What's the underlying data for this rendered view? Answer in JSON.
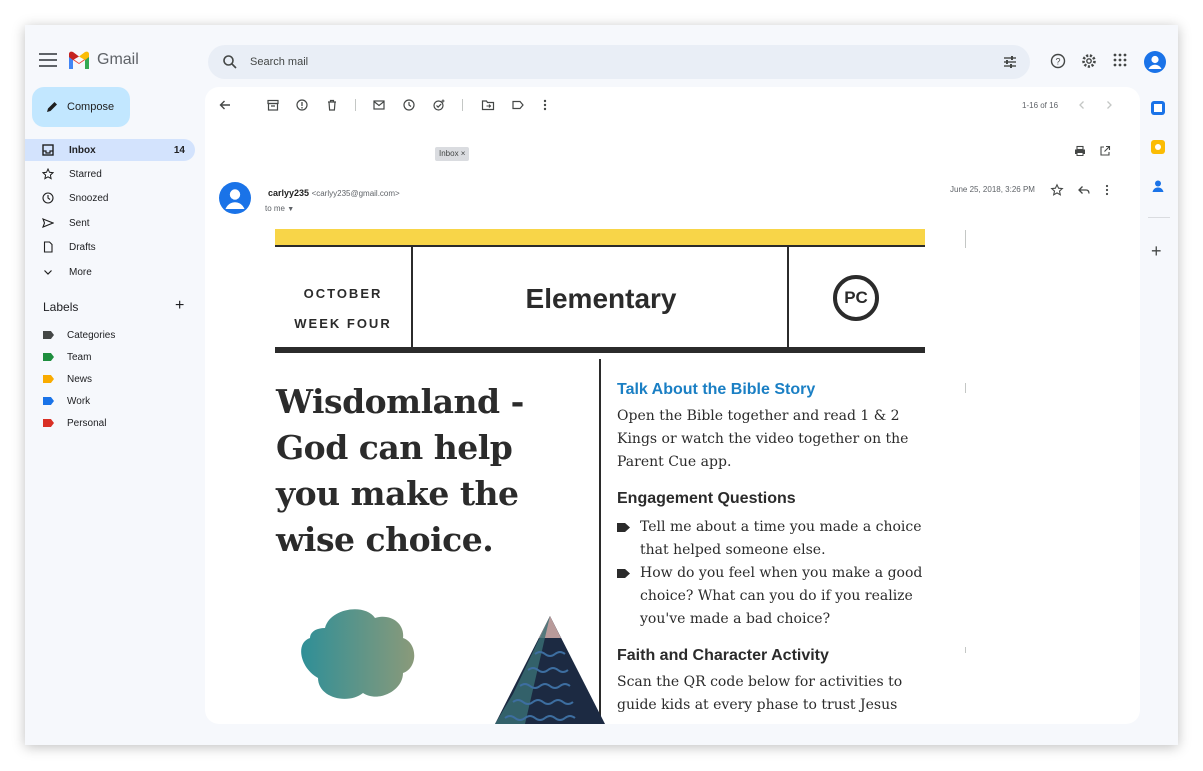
{
  "app": {
    "name": "Gmail"
  },
  "search": {
    "placeholder": "Search mail"
  },
  "sidebar": {
    "compose_label": "Compose",
    "items": [
      {
        "label": "Inbox",
        "count": "14"
      },
      {
        "label": "Starred"
      },
      {
        "label": "Snoozed"
      },
      {
        "label": "Sent"
      },
      {
        "label": "Drafts"
      },
      {
        "label": "More"
      }
    ],
    "labels_heading": "Labels",
    "labels": [
      {
        "label": "Categories",
        "color": "#444746"
      },
      {
        "label": "Team",
        "color": "#1e8e3e"
      },
      {
        "label": "News",
        "color": "#f9ab00"
      },
      {
        "label": "Work",
        "color": "#1a73e8"
      },
      {
        "label": "Personal",
        "color": "#d93025"
      }
    ]
  },
  "toolbar": {
    "pager": "1-16 of 16"
  },
  "message": {
    "chip": "Inbox ×",
    "sender_name": "carlyy235",
    "sender_email": "<carlyy235@gmail.com>",
    "to": "to me",
    "date": "June 25, 2018, 3:26 PM"
  },
  "email": {
    "month": "OCTOBER",
    "week": "WEEK FOUR",
    "title": "Elementary",
    "logo": "PC",
    "headline": "Wisdomland - God can help you make the wise choice.",
    "section1_title": "Talk About the Bible Story",
    "section1_body": "Open the Bible together and read 1 & 2 Kings or watch the video together on the Parent Cue app.",
    "section2_title": "Engagement Questions",
    "questions": [
      "Tell me about a time you made a choice that helped someone else.",
      "How do you feel when you make a good choice? What can you do if you realize you've made a bad choice?"
    ],
    "section3_title": "Faith and Character Activity",
    "section3_body": "Scan the QR code below for activities to guide kids at every phase to trust Jesus"
  },
  "colors": {
    "accent": "#c2e7ff",
    "highlight_bar": "#f8d548",
    "section_blue": "#1a7fc4"
  }
}
